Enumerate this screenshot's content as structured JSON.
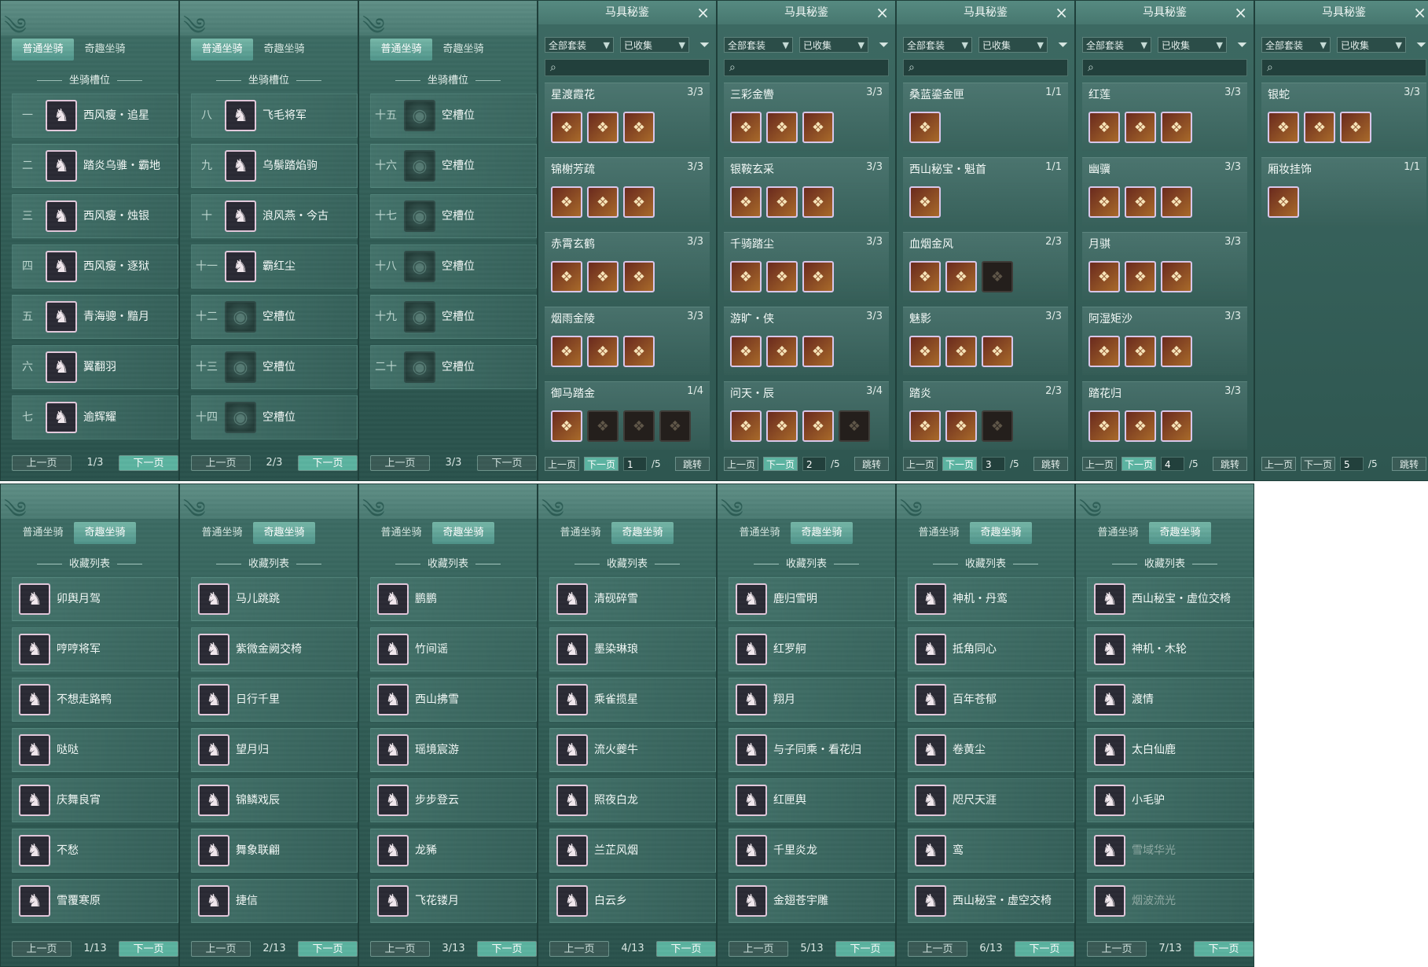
{
  "tabs": {
    "normal": "普通坐骑",
    "fun": "奇趣坐骑"
  },
  "pager": {
    "prev": "上一页",
    "next": "下一页",
    "jump": "跳转"
  },
  "slot_title": "坐骑槽位",
  "collection_title": "收藏列表",
  "armor": {
    "title": "马具秘鉴",
    "filter_all": "全部套装",
    "filter_collected": "已收集",
    "close": "×",
    "total": "/5"
  },
  "mount_slot_pages": [
    {
      "page": "1/3",
      "rows": [
        {
          "num": "一",
          "name": "西风瘦・追星",
          "icon": "horse-icon",
          "empty": false
        },
        {
          "num": "二",
          "name": "踏炎乌骓・霸地",
          "icon": "horse-icon",
          "empty": false
        },
        {
          "num": "三",
          "name": "西风瘦・烛银",
          "icon": "horse-icon",
          "empty": false
        },
        {
          "num": "四",
          "name": "西风瘦・逐狱",
          "icon": "horse-icon",
          "empty": false
        },
        {
          "num": "五",
          "name": "青海骢・黯月",
          "icon": "horse-icon",
          "empty": false
        },
        {
          "num": "六",
          "name": "翼翻羽",
          "icon": "horse-icon",
          "empty": false
        },
        {
          "num": "七",
          "name": "逾辉耀",
          "icon": "horse-icon",
          "empty": false
        }
      ]
    },
    {
      "page": "2/3",
      "rows": [
        {
          "num": "八",
          "name": "飞毛将军",
          "icon": "horse-icon",
          "empty": false
        },
        {
          "num": "九",
          "name": "乌鬃踏焰驹",
          "icon": "horse-icon",
          "empty": false
        },
        {
          "num": "十",
          "name": "浪风燕・今古",
          "icon": "horse-icon",
          "empty": false
        },
        {
          "num": "十一",
          "name": "霸红尘",
          "icon": "horse-icon",
          "empty": false
        },
        {
          "num": "十二",
          "name": "空槽位",
          "icon": "empty-slot-icon",
          "empty": true
        },
        {
          "num": "十三",
          "name": "空槽位",
          "icon": "empty-slot-icon",
          "empty": true
        },
        {
          "num": "十四",
          "name": "空槽位",
          "icon": "empty-slot-icon",
          "empty": true
        }
      ]
    },
    {
      "page": "3/3",
      "rows": [
        {
          "num": "十五",
          "name": "空槽位",
          "icon": "empty-slot-icon",
          "empty": true
        },
        {
          "num": "十六",
          "name": "空槽位",
          "icon": "empty-slot-icon",
          "empty": true
        },
        {
          "num": "十七",
          "name": "空槽位",
          "icon": "empty-slot-icon",
          "empty": true
        },
        {
          "num": "十八",
          "name": "空槽位",
          "icon": "empty-slot-icon",
          "empty": true
        },
        {
          "num": "十九",
          "name": "空槽位",
          "icon": "empty-slot-icon",
          "empty": true
        },
        {
          "num": "二十",
          "name": "空槽位",
          "icon": "empty-slot-icon",
          "empty": true
        },
        {
          "num": "",
          "name": "",
          "icon": "",
          "empty": true,
          "hidden": true
        }
      ]
    }
  ],
  "armor_pages": [
    {
      "page": "1",
      "sets": [
        {
          "name": "星渡霞花",
          "count": "3/3",
          "items": 3,
          "owned": 3
        },
        {
          "name": "锦榭芳疏",
          "count": "3/3",
          "items": 3,
          "owned": 3
        },
        {
          "name": "赤霄玄鹤",
          "count": "3/3",
          "items": 3,
          "owned": 3
        },
        {
          "name": "烟雨金陵",
          "count": "3/3",
          "items": 3,
          "owned": 3
        },
        {
          "name": "御马踏金",
          "count": "1/4",
          "items": 4,
          "owned": 1
        }
      ]
    },
    {
      "page": "2",
      "sets": [
        {
          "name": "三彩金轡",
          "count": "3/3",
          "items": 3,
          "owned": 3
        },
        {
          "name": "银鞍玄采",
          "count": "3/3",
          "items": 3,
          "owned": 3
        },
        {
          "name": "千骑踏尘",
          "count": "3/3",
          "items": 3,
          "owned": 3
        },
        {
          "name": "游旷・侠",
          "count": "3/3",
          "items": 3,
          "owned": 3
        },
        {
          "name": "问天・辰",
          "count": "3/4",
          "items": 4,
          "owned": 3
        }
      ]
    },
    {
      "page": "3",
      "sets": [
        {
          "name": "桑蓝鎏金匣",
          "count": "1/1",
          "items": 1,
          "owned": 1
        },
        {
          "name": "西山秘宝・魁首",
          "count": "1/1",
          "items": 1,
          "owned": 1
        },
        {
          "name": "血烟金风",
          "count": "2/3",
          "items": 3,
          "owned": 2
        },
        {
          "name": "魅影",
          "count": "3/3",
          "items": 3,
          "owned": 3
        },
        {
          "name": "踏炎",
          "count": "2/3",
          "items": 3,
          "owned": 2
        }
      ]
    },
    {
      "page": "4",
      "sets": [
        {
          "name": "红莲",
          "count": "3/3",
          "items": 3,
          "owned": 3
        },
        {
          "name": "幽骥",
          "count": "3/3",
          "items": 3,
          "owned": 3
        },
        {
          "name": "月骐",
          "count": "3/3",
          "items": 3,
          "owned": 3
        },
        {
          "name": "阿湿矩沙",
          "count": "3/3",
          "items": 3,
          "owned": 3
        },
        {
          "name": "踏花归",
          "count": "3/3",
          "items": 3,
          "owned": 3
        }
      ]
    },
    {
      "page": "5",
      "sets": [
        {
          "name": "银蛇",
          "count": "3/3",
          "items": 3,
          "owned": 3
        },
        {
          "name": "厢妆挂饰",
          "count": "1/1",
          "items": 1,
          "owned": 1
        }
      ]
    }
  ],
  "collection_pages": [
    {
      "page": "1/13",
      "names": [
        "卯舆月驾",
        "哼哼将军",
        "不想走路鸭",
        "哒哒",
        "庆舞良宵",
        "不愁",
        "雪覆寒原"
      ]
    },
    {
      "page": "2/13",
      "names": [
        "马儿跳跳",
        "紫微金阙交椅",
        "日行千里",
        "望月归",
        "锦鳞戏辰",
        "舞象联翩",
        "捷信"
      ]
    },
    {
      "page": "3/13",
      "names": [
        "鹏鹏",
        "竹间谣",
        "西山拂雪",
        "瑶境宸游",
        "步步登云",
        "龙豨",
        "飞花镂月"
      ]
    },
    {
      "page": "4/13",
      "names": [
        "清砚碎雪",
        "墨染琳琅",
        "乘雀揽星",
        "流火夔牛",
        "照夜白龙",
        "兰芷风烟",
        "白云乡"
      ]
    },
    {
      "page": "5/13",
      "names": [
        "鹿归雪明",
        "红罗舸",
        "翔月",
        "与子同乘・看花归",
        "红匣舆",
        "千里炎龙",
        "金翅苍宇雕"
      ]
    },
    {
      "page": "6/13",
      "names": [
        "神机・丹鸾",
        "抵角同心",
        "百年苍郁",
        "卷黄尘",
        "咫尺天涯",
        "鸾",
        "西山秘宝・虚空交椅"
      ]
    },
    {
      "page": "7/13",
      "names": [
        "西山秘宝・虚位交椅",
        "神机・木轮",
        "渡情",
        "太白仙鹿",
        "小毛驴",
        "雪域华光",
        "烟波流光"
      ]
    }
  ]
}
